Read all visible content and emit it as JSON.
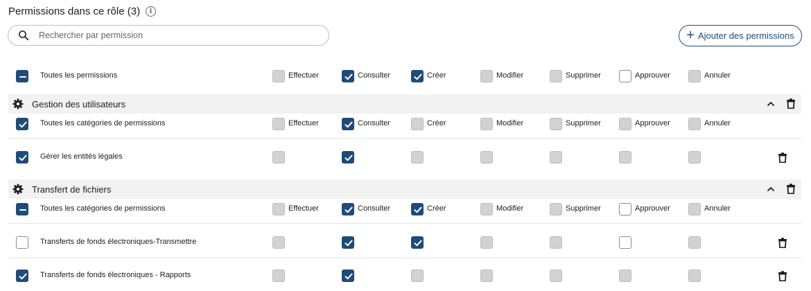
{
  "header": {
    "title": "Permissions dans ce rôle (3)",
    "info_icon": "info-circle-icon"
  },
  "search": {
    "placeholder": "Rechercher par permission"
  },
  "add_button": {
    "label": "Ajouter des permissions"
  },
  "columns": [
    "Effectuer",
    "Consulter",
    "Créer",
    "Modifier",
    "Supprimer",
    "Approuver",
    "Annuler"
  ],
  "global_row": {
    "label": "Toutes les permissions",
    "state": "indeterminate",
    "cells": [
      "gray",
      "checked",
      "checked",
      "gray",
      "gray",
      "white",
      "gray"
    ]
  },
  "sections": [
    {
      "title": "Gestion des utilisateurs",
      "all_row": {
        "label": "Toutes les catégories de permissions",
        "state": "checked",
        "cells": [
          "gray",
          "checked",
          "gray",
          "gray",
          "gray",
          "gray",
          "gray"
        ]
      },
      "rows": [
        {
          "label": "Gérer les entités légales",
          "state": "checked",
          "cells": [
            "gray",
            "checked",
            "gray",
            "gray",
            "gray",
            "gray",
            "gray"
          ]
        }
      ]
    },
    {
      "title": "Transfert de fichiers",
      "all_row": {
        "label": "Toutes les catégories de permissions",
        "state": "indeterminate",
        "cells": [
          "gray",
          "checked",
          "checked",
          "gray",
          "gray",
          "white",
          "gray"
        ]
      },
      "rows": [
        {
          "label": "Transferts de fonds électroniques-Transmettre",
          "state": "unchecked",
          "cells": [
            "gray",
            "checked",
            "checked",
            "gray",
            "gray",
            "white",
            "gray"
          ]
        },
        {
          "label": "Transferts de fonds électroniques - Rapports",
          "state": "checked",
          "cells": [
            "gray",
            "checked",
            "gray",
            "gray",
            "gray",
            "gray",
            "gray"
          ]
        }
      ]
    }
  ],
  "colors": {
    "accent": "#1e4b7a",
    "disabled_fill": "#d2d2d2",
    "section_bg": "#f2f2f2"
  }
}
